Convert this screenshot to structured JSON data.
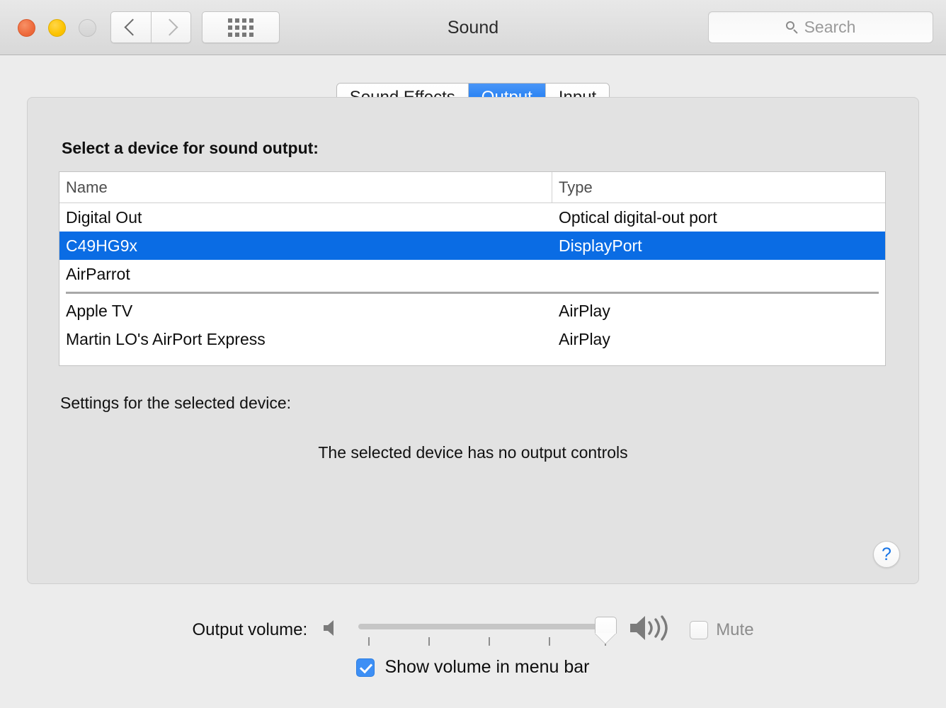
{
  "window": {
    "title": "Sound",
    "traffic_lights": [
      "close-button",
      "minimize-button",
      "zoom-button"
    ],
    "back_label": "Back",
    "forward_label": "Forward",
    "show_all_label": "Show All"
  },
  "search": {
    "placeholder": "Search",
    "value": ""
  },
  "tabs": [
    {
      "label": "Sound Effects",
      "active": false
    },
    {
      "label": "Output",
      "active": true
    },
    {
      "label": "Input",
      "active": false
    }
  ],
  "main": {
    "section_title": "Select a device for sound output:",
    "table": {
      "headers": {
        "name": "Name",
        "type": "Type"
      },
      "rows": [
        {
          "name": "Digital Out",
          "type": "Optical digital-out port",
          "selected": false
        },
        {
          "name": "C49HG9x",
          "type": "DisplayPort",
          "selected": true
        },
        {
          "name": "AirParrot",
          "type": "",
          "selected": false
        },
        {
          "name": "Apple TV",
          "type": "AirPlay",
          "selected": false
        },
        {
          "name": "Martin LO's AirPort Express",
          "type": "AirPlay",
          "selected": false
        }
      ],
      "separator_after_index": 2
    },
    "settings_label": "Settings for the selected device:",
    "no_controls_message": "The selected device has no output controls",
    "help_label": "?"
  },
  "bottom": {
    "volume_label": "Output volume:",
    "volume_percent": 94,
    "slider_min_icon": "speaker-mute-icon",
    "slider_max_icon": "speaker-loud-icon",
    "mute_label": "Mute",
    "mute_checked": false,
    "show_volume_label": "Show volume in menu bar",
    "show_volume_checked": true
  },
  "colors": {
    "accent_blue": "#0a6ce4",
    "tab_active_blue": "#0a6ff0",
    "checkbox_blue": "#3d8ff5",
    "help_blue": "#1573e6",
    "window_bg": "#ececec",
    "panel_bg": "#e2e2e2",
    "close_red": "#ee6a3c",
    "minimize_yellow": "#fcc300",
    "zoom_gray": "#d4d4d4"
  }
}
